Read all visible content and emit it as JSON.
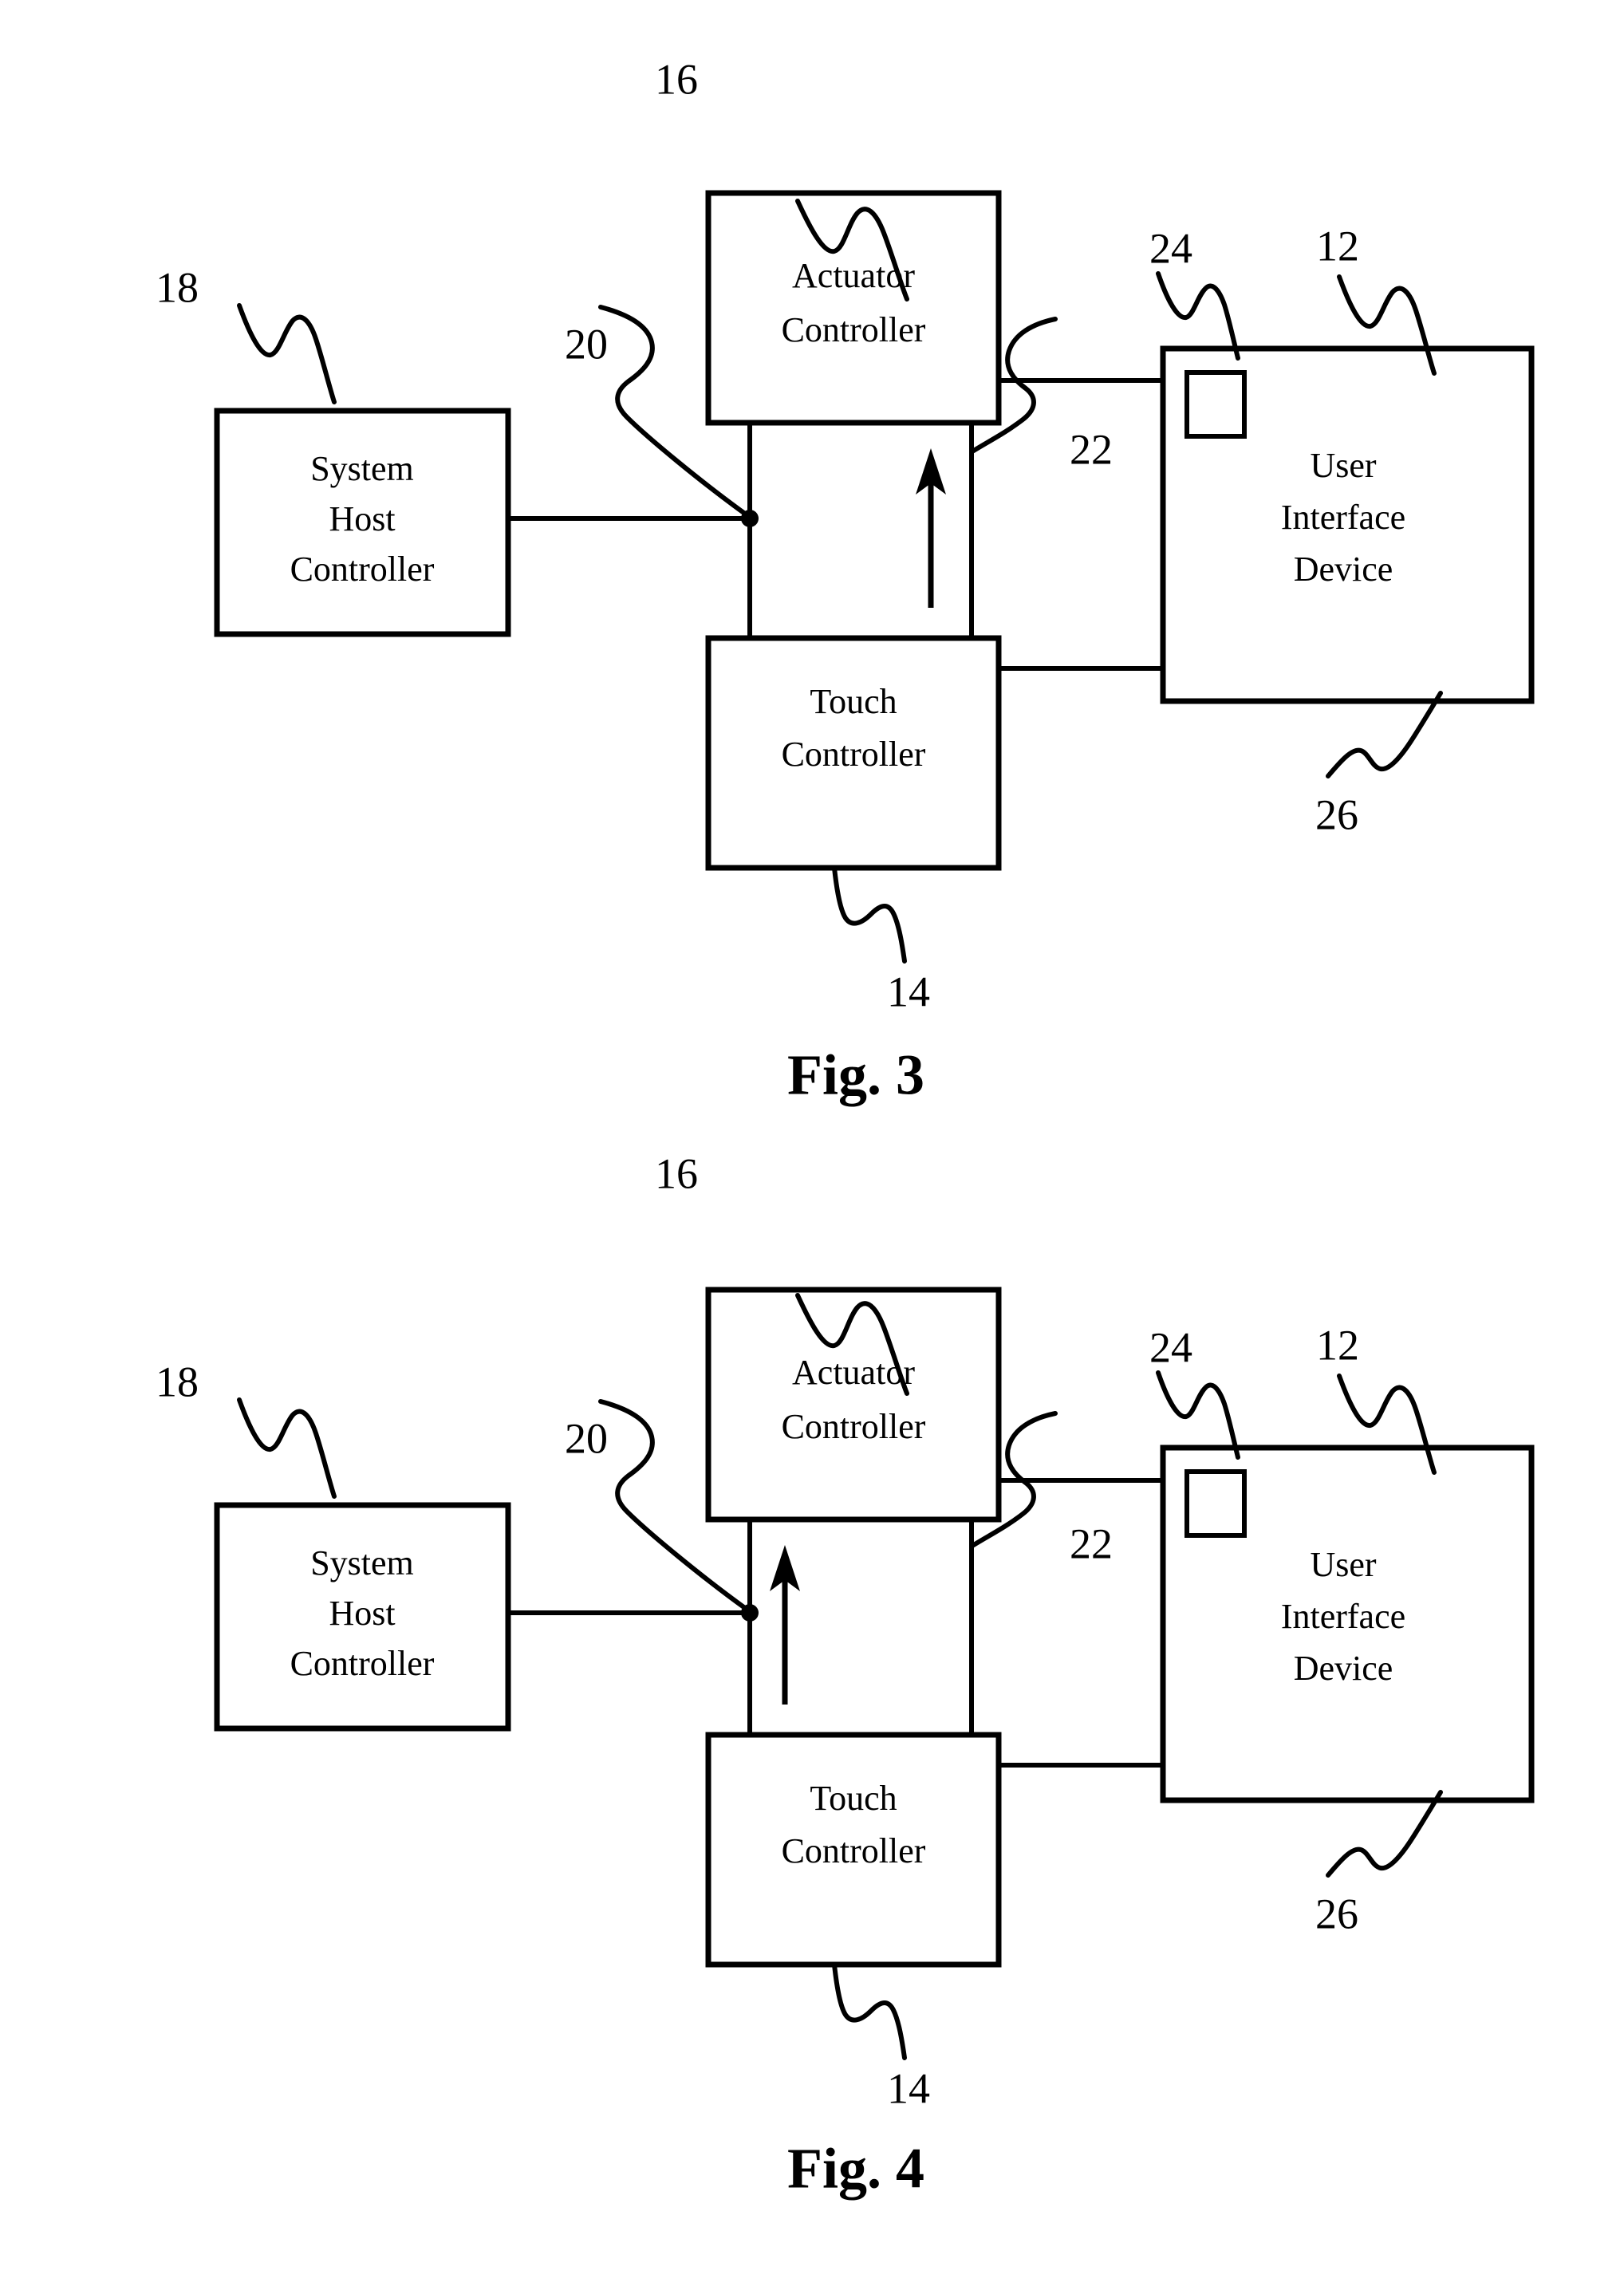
{
  "document": {
    "type": "patent-drawing-sheet",
    "background_color": "#ffffff",
    "ink_color": "#000000"
  },
  "figures": [
    {
      "id": "fig3",
      "caption": "Fig. 3",
      "blocks": {
        "system_host_controller": {
          "line1": "System",
          "line2": "Host",
          "line3": "Controller"
        },
        "actuator_controller": {
          "line1": "Actuator",
          "line2": "Controller"
        },
        "touch_controller": {
          "line1": "Touch",
          "line2": "Controller"
        },
        "user_interface_device": {
          "line1": "User",
          "line2": "Interface",
          "line3": "Device"
        }
      },
      "reference_numerals": {
        "system_host_controller": "18",
        "actuator_controller": "16",
        "bus": "20",
        "middle_column": "22",
        "touch_controller": "14",
        "user_interface_device": "12",
        "small_element": "24",
        "device_body": "26"
      },
      "arrow_side": "right"
    },
    {
      "id": "fig4",
      "caption": "Fig. 4",
      "blocks": {
        "system_host_controller": {
          "line1": "System",
          "line2": "Host",
          "line3": "Controller"
        },
        "actuator_controller": {
          "line1": "Actuator",
          "line2": "Controller"
        },
        "touch_controller": {
          "line1": "Touch",
          "line2": "Controller"
        },
        "user_interface_device": {
          "line1": "User",
          "line2": "Interface",
          "line3": "Device"
        }
      },
      "reference_numerals": {
        "system_host_controller": "18",
        "actuator_controller": "16",
        "bus": "20",
        "middle_column": "22",
        "touch_controller": "14",
        "user_interface_device": "12",
        "small_element": "24",
        "device_body": "26"
      },
      "arrow_side": "left"
    }
  ]
}
